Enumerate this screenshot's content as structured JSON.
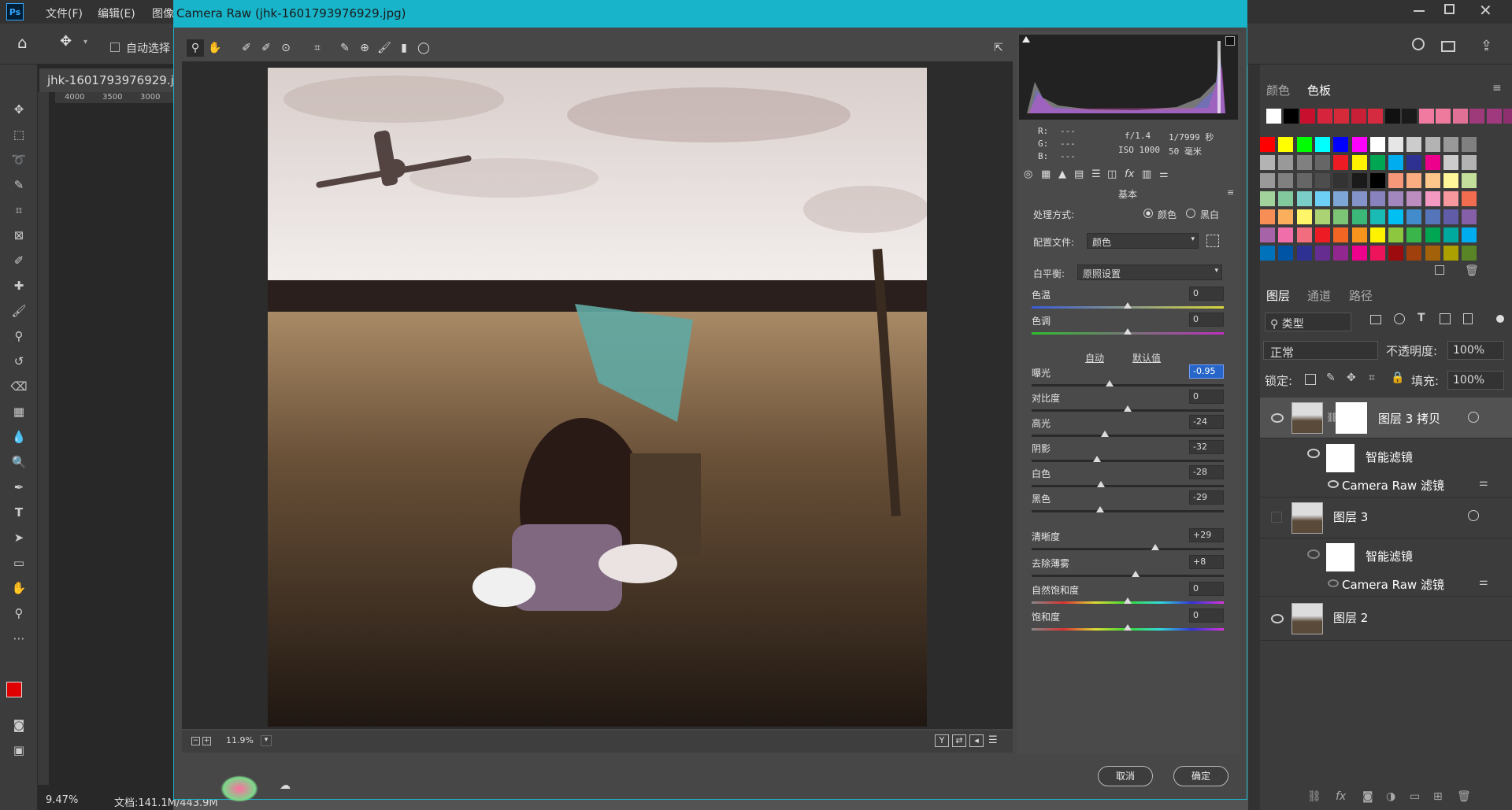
{
  "menu": {
    "ps_logo": "Ps",
    "items": [
      "文件(F)",
      "编辑(E)",
      "图像"
    ],
    "window_controls": [
      "minimize-icon",
      "restore-icon",
      "close-icon"
    ]
  },
  "options_bar": {
    "auto_select_label": "自动选择"
  },
  "document": {
    "tab_name": "jhk-1601793976929.jp",
    "ruler_ticks": [
      "4000",
      "3500",
      "3000"
    ],
    "zoom": "9.47%",
    "doc_info": "文档:141.1M/443.9M"
  },
  "camera_raw": {
    "title": "Camera Raw (jhk-1601793976929.jpg)",
    "preview_zoom": "11.9%",
    "histogram_info": {
      "r_label": "R:",
      "g_label": "G:",
      "b_label": "B:",
      "r": "---",
      "g": "---",
      "b": "---",
      "aperture": "f/1.4",
      "shutter": "1/7999 秒",
      "iso": "ISO 1000",
      "focal": "50 毫米"
    },
    "panel_title": "基本",
    "treatment_label": "处理方式:",
    "treatment_color": "颜色",
    "treatment_bw": "黑白",
    "profile_label": "配置文件:",
    "profile_value": "颜色",
    "wb_label": "白平衡:",
    "wb_value": "原照设置",
    "auto_label": "自动",
    "default_label": "默认值",
    "sliders": [
      {
        "label": "色温",
        "value": "0",
        "level": 0.5
      },
      {
        "label": "色调",
        "value": "0",
        "level": 0.5
      },
      {
        "label": "曝光",
        "value": "-0.95",
        "level": 0.405
      },
      {
        "label": "对比度",
        "value": "0",
        "level": 0.5
      },
      {
        "label": "高光",
        "value": "-24",
        "level": 0.38
      },
      {
        "label": "阴影",
        "value": "-32",
        "level": 0.34
      },
      {
        "label": "白色",
        "value": "-28",
        "level": 0.36
      },
      {
        "label": "黑色",
        "value": "-29",
        "level": 0.355
      },
      {
        "label": "清晰度",
        "value": "+29",
        "level": 0.645
      },
      {
        "label": "去除薄雾",
        "value": "+8",
        "level": 0.54
      },
      {
        "label": "自然饱和度",
        "value": "0",
        "level": 0.5
      },
      {
        "label": "饱和度",
        "value": "0",
        "level": 0.5
      }
    ],
    "cancel_label": "取消",
    "ok_label": "确定"
  },
  "right_panel": {
    "tabs": [
      "颜色",
      "色板"
    ],
    "layer_tabs": [
      "图层",
      "通道",
      "路径"
    ],
    "filter_kind": "类型",
    "blend_mode": "正常",
    "opacity_label": "不透明度:",
    "opacity_value": "100%",
    "lock_label": "锁定:",
    "fill_label": "填充:",
    "fill_value": "100%",
    "layers": [
      {
        "name": "图层 3 拷贝"
      },
      {
        "name": "智能滤镜"
      },
      {
        "name": "Camera Raw 滤镜"
      },
      {
        "name": "图层 3"
      },
      {
        "name": "智能滤镜"
      },
      {
        "name": "Camera Raw 滤镜"
      },
      {
        "name": "图层 2"
      }
    ]
  },
  "colors": {
    "accent": "#18b4c9",
    "foreground": "#e00000",
    "background": "#ffffff"
  }
}
